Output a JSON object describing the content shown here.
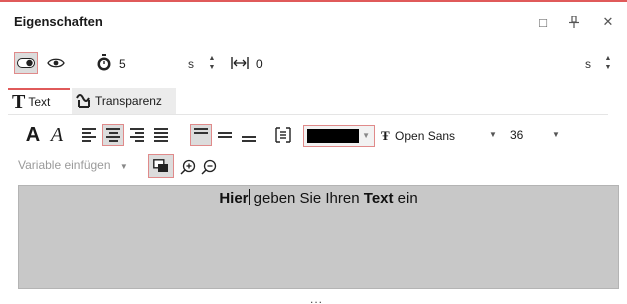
{
  "panel": {
    "title": "Eigenschaften",
    "window_buttons": {
      "maximize": "□",
      "pin": "⊥",
      "close": "✕"
    }
  },
  "timing": {
    "duration_value": "5",
    "duration_unit": "s",
    "offset_value": "0",
    "offset_unit": "s"
  },
  "tabs": [
    {
      "label": "Text",
      "active": true
    },
    {
      "label": "Transparenz",
      "active": false
    }
  ],
  "format_toolbar": {
    "bold_glyph": "A",
    "italic_glyph": "A",
    "color_value": "#000000",
    "font_family": "Open Sans",
    "font_size": "36"
  },
  "variable_select": {
    "placeholder": "Variable einfügen"
  },
  "editor": {
    "segments": [
      {
        "text": "Hier",
        "bold": true
      },
      {
        "text": " geben Sie Ihren ",
        "bold": false
      },
      {
        "text": "Text",
        "bold": true
      },
      {
        "text": " ein",
        "bold": false
      }
    ],
    "background": "#c8c8c8"
  },
  "more": {
    "label": "..."
  },
  "colors": {
    "accent": "#e05a5a",
    "selected_bg": "#dcdcdc"
  }
}
